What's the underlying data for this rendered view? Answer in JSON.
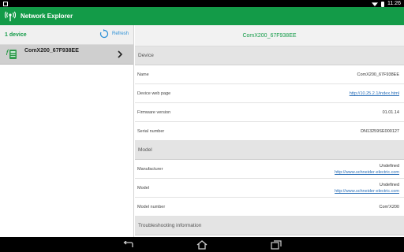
{
  "status_bar": {
    "time": "11:26"
  },
  "app": {
    "title": "Network Explorer"
  },
  "left_panel": {
    "device_count": "1 device",
    "refresh_label": "Refresh",
    "devices": [
      {
        "name": "ComX200_67F938EE"
      }
    ]
  },
  "right_panel": {
    "selected_device": "ComX200_67F938EE",
    "sections": {
      "device": "Device",
      "model": "Model",
      "troubleshooting": "Troubleshooting information"
    },
    "device_fields": {
      "name_label": "Name",
      "name_value": "ComX200_67F938EE",
      "webpage_label": "Device web page",
      "webpage_value": "http://10.25.2.1/index.html",
      "firmware_label": "Firmware version",
      "firmware_value": "01.01.14",
      "serial_label": "Serial number",
      "serial_value": "DN13259SE000127"
    },
    "model_fields": {
      "manufacturer_label": "Manufacturer",
      "manufacturer_value": "Undefined",
      "manufacturer_link": "http://www.schneider-electric.com",
      "model_label": "Model",
      "model_value": "Undefined",
      "model_link": "http://www.schneider-electric.com",
      "model_number_label": "Model number",
      "model_number_value": "Com'X200"
    }
  },
  "colors": {
    "brand_green": "#139b48",
    "link_blue": "#2a6fb8"
  }
}
